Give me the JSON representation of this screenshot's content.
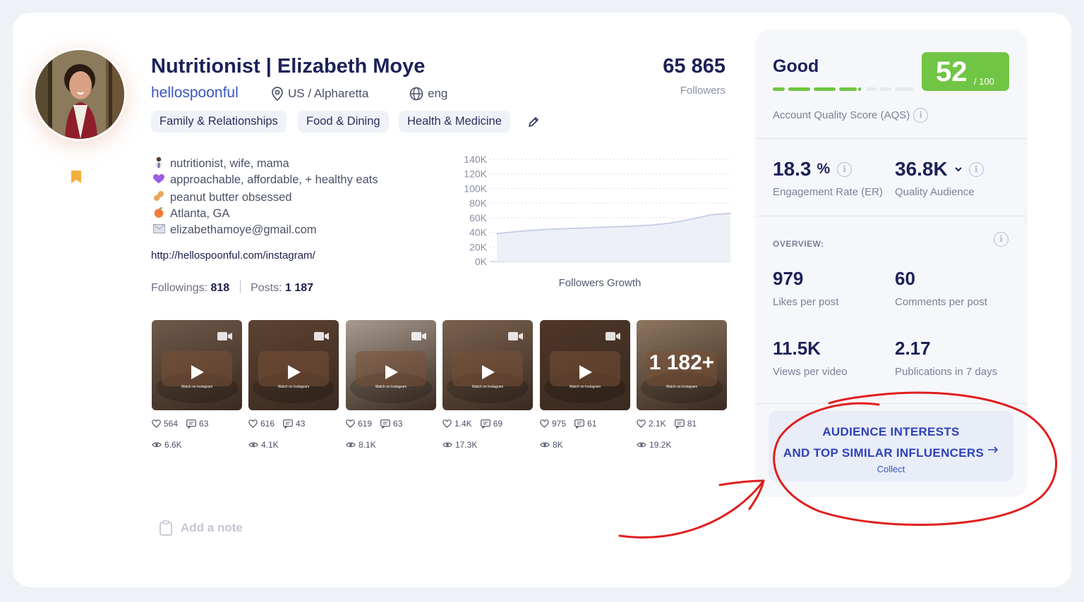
{
  "profile": {
    "name": "Nutritionist | Elizabeth Moye",
    "handle": "hellospoonful",
    "location": "US / Alpharetta",
    "language": "eng",
    "followers_count": "65 865",
    "followers_label": "Followers",
    "tags": [
      "Family & Relationships",
      "Food & Dining",
      "Health & Medicine"
    ],
    "bio": [
      {
        "icon": "person-emoji",
        "text": "nutritionist, wife, mama"
      },
      {
        "icon": "purple-heart-emoji",
        "text": "approachable, affordable, + healthy eats"
      },
      {
        "icon": "peanut-emoji",
        "text": "peanut butter obsessed"
      },
      {
        "icon": "peach-emoji",
        "text": "Atlanta, GA"
      },
      {
        "icon": "envelope-icon",
        "text": "elizabethamoye@gmail.com"
      }
    ],
    "link": "http://hellospoonful.com/instagram/",
    "followings_label": "Followings:",
    "followings_value": "818",
    "posts_label": "Posts:",
    "posts_value": "1 187"
  },
  "chart_data": {
    "type": "area",
    "title": "Followers Growth",
    "xlabel": "",
    "ylabel": "",
    "ytick_labels": [
      "140K",
      "120K",
      "100K",
      "80K",
      "60K",
      "40K",
      "20K",
      "0K"
    ],
    "ylim": [
      0,
      140000
    ],
    "grid": true,
    "series": [
      {
        "values": [
          38000,
          41000,
          43000,
          44500,
          45500,
          46500,
          47500,
          48500,
          50000,
          53000,
          58000,
          64000,
          66000
        ]
      }
    ],
    "color": "#c9cfe6"
  },
  "posts": [
    {
      "likes": "564",
      "comments": "63",
      "views": "6.6K",
      "bg": "#6f5a4b"
    },
    {
      "likes": "616",
      "comments": "43",
      "views": "4.1K",
      "bg": "#5d4333"
    },
    {
      "likes": "619",
      "comments": "63",
      "views": "8.1K",
      "bg": "#a79a8e"
    },
    {
      "likes": "1.4K",
      "comments": "69",
      "views": "17.3K",
      "bg": "#7a6250"
    },
    {
      "likes": "975",
      "comments": "61",
      "views": "8K",
      "bg": "#4e3628"
    },
    {
      "likes": "2.1K",
      "comments": "81",
      "views": "19.2K",
      "bg": "#8c7660",
      "overlay": "1 182+"
    }
  ],
  "thumb_caption": "Watch on Instagram",
  "note_placeholder": "Add a note",
  "quality": {
    "rating": "Good",
    "score": "52",
    "score_max": "/ 100",
    "score_fraction": 0.52,
    "score_color": "#71c545",
    "aqs_label": "Account Quality Score (AQS)",
    "er_value": "18.3",
    "er_unit": "%",
    "er_label": "Engagement Rate (ER)",
    "qa_value": "36.8K",
    "qa_label": "Quality Audience",
    "overview_label": "OVERVIEW:",
    "stats": [
      {
        "value": "979",
        "label": "Likes per post"
      },
      {
        "value": "60",
        "label": "Comments per post"
      },
      {
        "value": "11.5K",
        "label": "Views per video"
      },
      {
        "value": "2.17",
        "label": "Publications in 7 days"
      }
    ]
  },
  "cta": {
    "line1": "AUDIENCE INTERESTS",
    "line2": "AND TOP SIMILAR INFLUENCERS",
    "line3": "Collect"
  }
}
